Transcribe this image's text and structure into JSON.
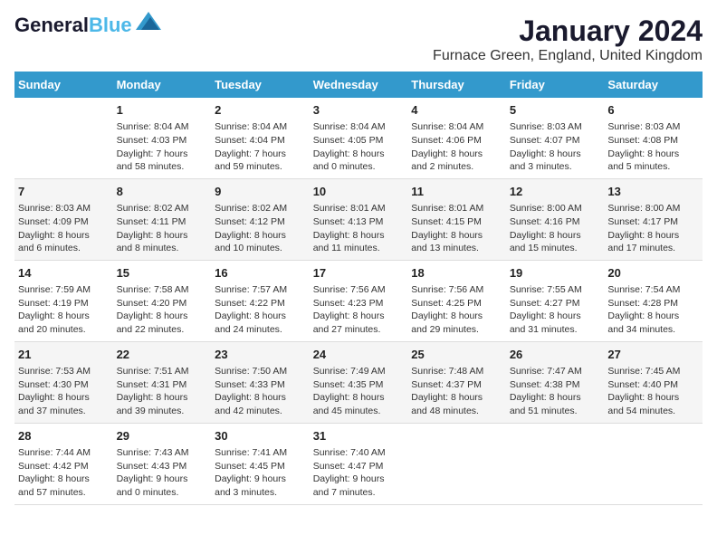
{
  "header": {
    "logo_line1": "General",
    "logo_line2": "Blue",
    "month_title": "January 2024",
    "location": "Furnace Green, England, United Kingdom"
  },
  "days_of_week": [
    "Sunday",
    "Monday",
    "Tuesday",
    "Wednesday",
    "Thursday",
    "Friday",
    "Saturday"
  ],
  "weeks": [
    [
      {
        "day": "",
        "info": ""
      },
      {
        "day": "1",
        "info": "Sunrise: 8:04 AM\nSunset: 4:03 PM\nDaylight: 7 hours\nand 58 minutes."
      },
      {
        "day": "2",
        "info": "Sunrise: 8:04 AM\nSunset: 4:04 PM\nDaylight: 7 hours\nand 59 minutes."
      },
      {
        "day": "3",
        "info": "Sunrise: 8:04 AM\nSunset: 4:05 PM\nDaylight: 8 hours\nand 0 minutes."
      },
      {
        "day": "4",
        "info": "Sunrise: 8:04 AM\nSunset: 4:06 PM\nDaylight: 8 hours\nand 2 minutes."
      },
      {
        "day": "5",
        "info": "Sunrise: 8:03 AM\nSunset: 4:07 PM\nDaylight: 8 hours\nand 3 minutes."
      },
      {
        "day": "6",
        "info": "Sunrise: 8:03 AM\nSunset: 4:08 PM\nDaylight: 8 hours\nand 5 minutes."
      }
    ],
    [
      {
        "day": "7",
        "info": "Sunrise: 8:03 AM\nSunset: 4:09 PM\nDaylight: 8 hours\nand 6 minutes."
      },
      {
        "day": "8",
        "info": "Sunrise: 8:02 AM\nSunset: 4:11 PM\nDaylight: 8 hours\nand 8 minutes."
      },
      {
        "day": "9",
        "info": "Sunrise: 8:02 AM\nSunset: 4:12 PM\nDaylight: 8 hours\nand 10 minutes."
      },
      {
        "day": "10",
        "info": "Sunrise: 8:01 AM\nSunset: 4:13 PM\nDaylight: 8 hours\nand 11 minutes."
      },
      {
        "day": "11",
        "info": "Sunrise: 8:01 AM\nSunset: 4:15 PM\nDaylight: 8 hours\nand 13 minutes."
      },
      {
        "day": "12",
        "info": "Sunrise: 8:00 AM\nSunset: 4:16 PM\nDaylight: 8 hours\nand 15 minutes."
      },
      {
        "day": "13",
        "info": "Sunrise: 8:00 AM\nSunset: 4:17 PM\nDaylight: 8 hours\nand 17 minutes."
      }
    ],
    [
      {
        "day": "14",
        "info": "Sunrise: 7:59 AM\nSunset: 4:19 PM\nDaylight: 8 hours\nand 20 minutes."
      },
      {
        "day": "15",
        "info": "Sunrise: 7:58 AM\nSunset: 4:20 PM\nDaylight: 8 hours\nand 22 minutes."
      },
      {
        "day": "16",
        "info": "Sunrise: 7:57 AM\nSunset: 4:22 PM\nDaylight: 8 hours\nand 24 minutes."
      },
      {
        "day": "17",
        "info": "Sunrise: 7:56 AM\nSunset: 4:23 PM\nDaylight: 8 hours\nand 27 minutes."
      },
      {
        "day": "18",
        "info": "Sunrise: 7:56 AM\nSunset: 4:25 PM\nDaylight: 8 hours\nand 29 minutes."
      },
      {
        "day": "19",
        "info": "Sunrise: 7:55 AM\nSunset: 4:27 PM\nDaylight: 8 hours\nand 31 minutes."
      },
      {
        "day": "20",
        "info": "Sunrise: 7:54 AM\nSunset: 4:28 PM\nDaylight: 8 hours\nand 34 minutes."
      }
    ],
    [
      {
        "day": "21",
        "info": "Sunrise: 7:53 AM\nSunset: 4:30 PM\nDaylight: 8 hours\nand 37 minutes."
      },
      {
        "day": "22",
        "info": "Sunrise: 7:51 AM\nSunset: 4:31 PM\nDaylight: 8 hours\nand 39 minutes."
      },
      {
        "day": "23",
        "info": "Sunrise: 7:50 AM\nSunset: 4:33 PM\nDaylight: 8 hours\nand 42 minutes."
      },
      {
        "day": "24",
        "info": "Sunrise: 7:49 AM\nSunset: 4:35 PM\nDaylight: 8 hours\nand 45 minutes."
      },
      {
        "day": "25",
        "info": "Sunrise: 7:48 AM\nSunset: 4:37 PM\nDaylight: 8 hours\nand 48 minutes."
      },
      {
        "day": "26",
        "info": "Sunrise: 7:47 AM\nSunset: 4:38 PM\nDaylight: 8 hours\nand 51 minutes."
      },
      {
        "day": "27",
        "info": "Sunrise: 7:45 AM\nSunset: 4:40 PM\nDaylight: 8 hours\nand 54 minutes."
      }
    ],
    [
      {
        "day": "28",
        "info": "Sunrise: 7:44 AM\nSunset: 4:42 PM\nDaylight: 8 hours\nand 57 minutes."
      },
      {
        "day": "29",
        "info": "Sunrise: 7:43 AM\nSunset: 4:43 PM\nDaylight: 9 hours\nand 0 minutes."
      },
      {
        "day": "30",
        "info": "Sunrise: 7:41 AM\nSunset: 4:45 PM\nDaylight: 9 hours\nand 3 minutes."
      },
      {
        "day": "31",
        "info": "Sunrise: 7:40 AM\nSunset: 4:47 PM\nDaylight: 9 hours\nand 7 minutes."
      },
      {
        "day": "",
        "info": ""
      },
      {
        "day": "",
        "info": ""
      },
      {
        "day": "",
        "info": ""
      }
    ]
  ]
}
